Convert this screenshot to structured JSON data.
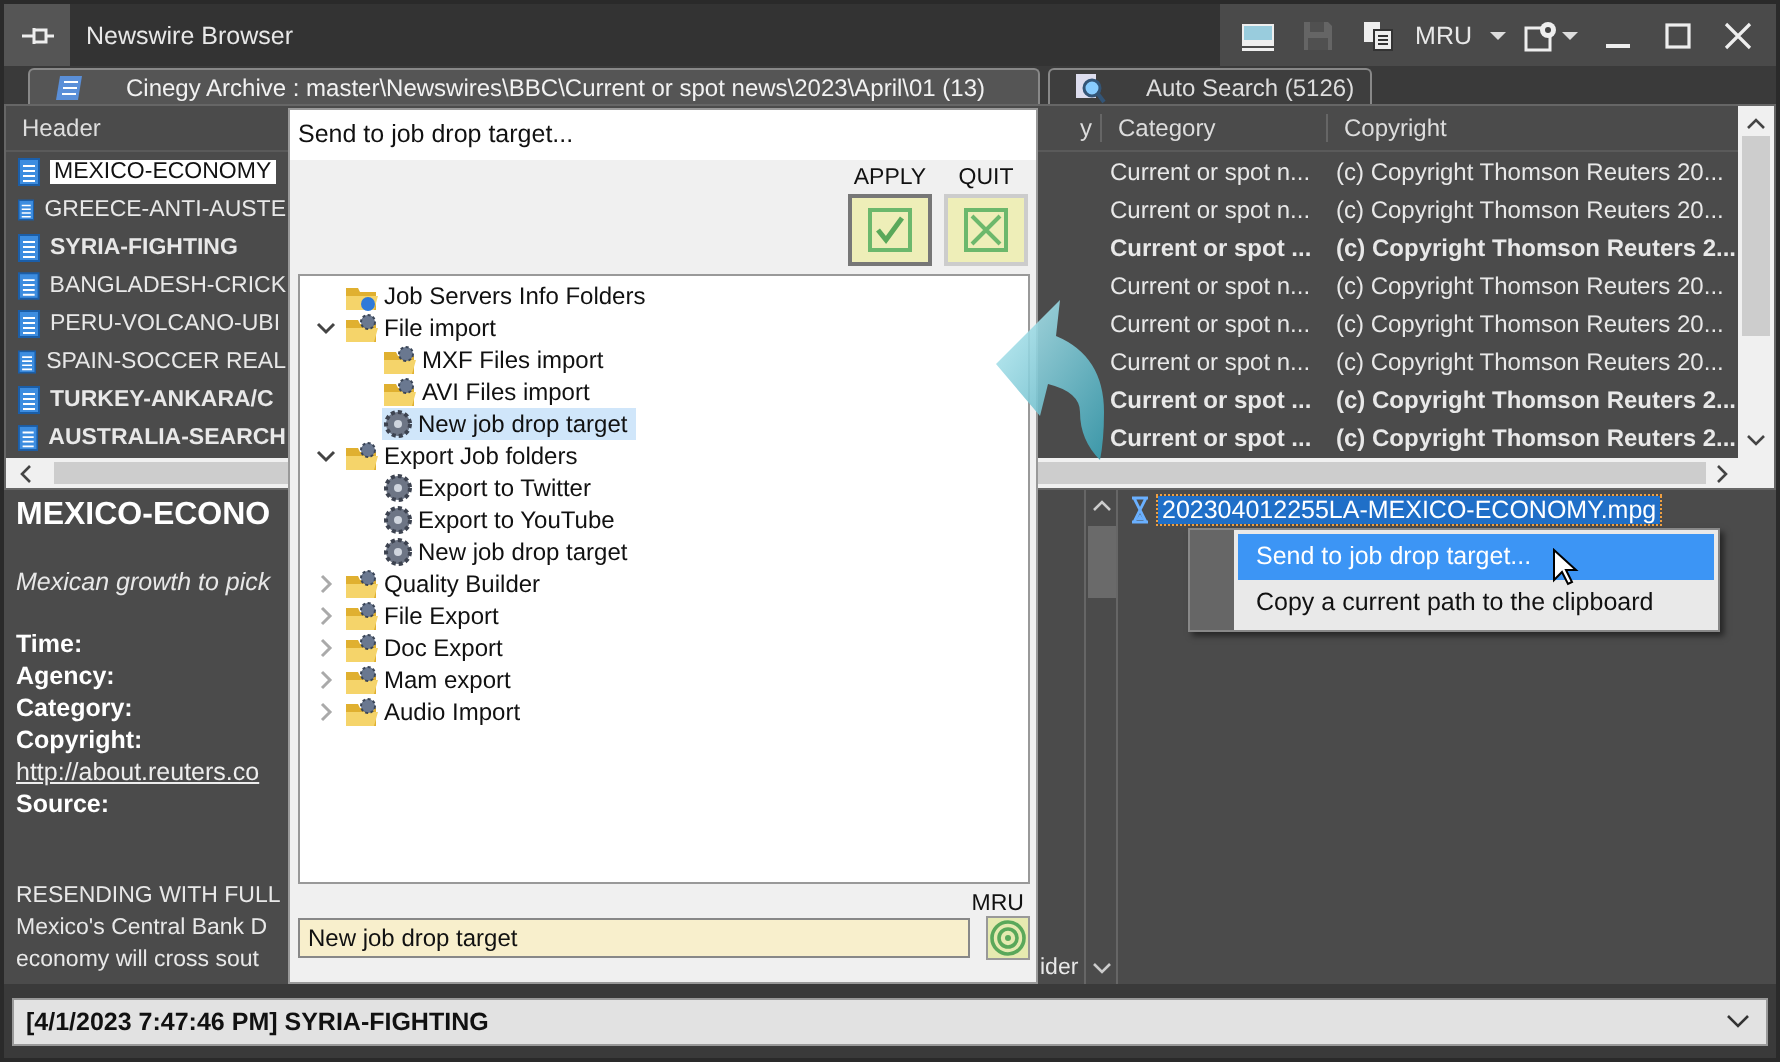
{
  "window": {
    "title": "Newswire Browser"
  },
  "toolbar": [
    {
      "kind": "monitor",
      "disabled": false
    },
    {
      "kind": "save",
      "disabled": true
    },
    {
      "kind": "copy",
      "disabled": false
    },
    {
      "kind": "mru",
      "label": "MRU",
      "disabled": false
    },
    {
      "kind": "settings",
      "disabled": false
    }
  ],
  "tabs": [
    {
      "label": "Cinegy Archive : master\\Newswires\\BBC\\Current or spot news\\2023\\April\\01 (13)",
      "selected": true
    },
    {
      "label": "Auto Search (5126)",
      "selected": false
    }
  ],
  "table": {
    "columns": [
      "Header",
      "y",
      "Category",
      "Copyright"
    ],
    "rows": [
      {
        "header": "MEXICO-ECONOMY",
        "category": "Current or spot n...",
        "copyright": "(c) Copyright Thomson Reuters 20...",
        "bold": false,
        "selected": true
      },
      {
        "header": "GREECE-ANTI-AUSTE",
        "category": "Current or spot n...",
        "copyright": "(c) Copyright Thomson Reuters 20...",
        "bold": false,
        "selected": false
      },
      {
        "header": "SYRIA-FIGHTING",
        "category": "Current or spot ...",
        "copyright": "(c) Copyright Thomson Reuters 2...",
        "bold": true,
        "selected": false
      },
      {
        "header": "BANGLADESH-CRICK",
        "category": "Current or spot n...",
        "copyright": "(c) Copyright Thomson Reuters 20...",
        "bold": false,
        "selected": false
      },
      {
        "header": "PERU-VOLCANO-UBI",
        "category": "Current or spot n...",
        "copyright": "(c) Copyright Thomson Reuters 20...",
        "bold": false,
        "selected": false
      },
      {
        "header": "SPAIN-SOCCER REAL",
        "category": "Current or spot n...",
        "copyright": "(c) Copyright Thomson Reuters 20...",
        "bold": false,
        "selected": false
      },
      {
        "header": "TURKEY-ANKARA/C",
        "category": "Current or spot ...",
        "copyright": "(c) Copyright Thomson Reuters 2...",
        "bold": true,
        "selected": false
      },
      {
        "header": "AUSTRALIA-SEARCH",
        "category": "Current or spot ...",
        "copyright": "(c) Copyright Thomson Reuters 2...",
        "bold": true,
        "selected": false
      }
    ]
  },
  "detail": {
    "title": "MEXICO-ECONO",
    "summary": "Mexican growth to pick",
    "fields": [
      "Time:",
      "Agency:",
      "Category:",
      "Copyright:"
    ],
    "link": "http://about.reuters.co",
    "source_label": "Source:",
    "body": [
      "RESENDING WITH FULL",
      "Mexico's Central Bank D",
      "economy will cross sout"
    ],
    "body_tail": "ider"
  },
  "files": [
    {
      "name": "202304012255LA-MEXICO-ECONOMY.mpg",
      "selected": true
    }
  ],
  "context_menu": [
    {
      "label": "Send to job drop target...",
      "selected": true
    },
    {
      "label": "Copy a current path to the clipboard",
      "selected": false
    }
  ],
  "dialog": {
    "title": "Send to job drop target...",
    "apply_label": "APPLY",
    "quit_label": "QUIT",
    "tree": [
      {
        "label": "Job Servers Info Folders",
        "kind": "info_folder",
        "selected": false
      },
      {
        "label": "File import",
        "kind": "folder",
        "expanded": true,
        "selected": false,
        "children": [
          {
            "label": "MXF Files import",
            "kind": "folder",
            "selected": false
          },
          {
            "label": "AVI Files import",
            "kind": "folder",
            "selected": false
          },
          {
            "label": "New job drop target",
            "kind": "job",
            "selected": true
          }
        ]
      },
      {
        "label": "Export Job folders",
        "kind": "folder",
        "expanded": true,
        "selected": false,
        "children": [
          {
            "label": "Export to Twitter",
            "kind": "job",
            "selected": false
          },
          {
            "label": "Export to YouTube",
            "kind": "job",
            "selected": false
          },
          {
            "label": "New job drop target",
            "kind": "job",
            "selected": false
          }
        ]
      },
      {
        "label": "Quality Builder",
        "kind": "folder",
        "expanded": false,
        "selected": false
      },
      {
        "label": "File Export",
        "kind": "folder",
        "expanded": false,
        "selected": false
      },
      {
        "label": "Doc Export",
        "kind": "folder",
        "expanded": false,
        "selected": false
      },
      {
        "label": "Mam export",
        "kind": "folder",
        "expanded": false,
        "selected": false
      },
      {
        "label": "Audio Import",
        "kind": "folder",
        "expanded": false,
        "selected": false
      }
    ],
    "mru_label": "MRU",
    "value": "New job drop target"
  },
  "status": {
    "value": "[4/1/2023 7:47:46 PM] SYRIA-FIGHTING"
  }
}
